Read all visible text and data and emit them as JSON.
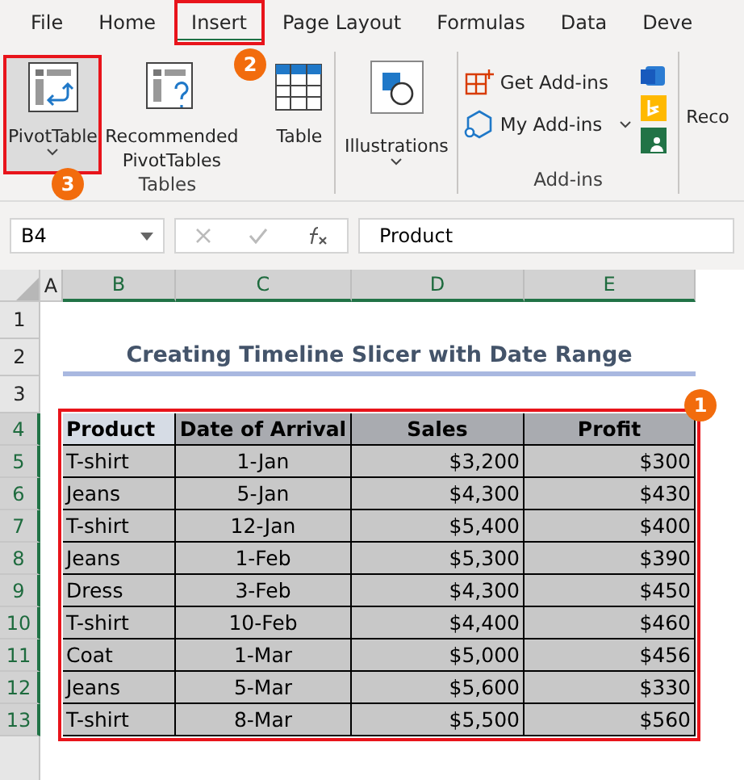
{
  "tabs": [
    {
      "label": "File",
      "selected": false
    },
    {
      "label": "Home",
      "selected": false
    },
    {
      "label": "Insert",
      "selected": true,
      "callout": "2"
    },
    {
      "label": "Page Layout",
      "selected": false
    },
    {
      "label": "Formulas",
      "selected": false
    },
    {
      "label": "Data",
      "selected": false
    },
    {
      "label": "Deve",
      "selected": false
    }
  ],
  "ribbon": {
    "groups": [
      {
        "label": "Tables",
        "buttons": [
          {
            "label": "PivotTable",
            "has_menu": true,
            "selected": true,
            "callout": "3"
          },
          {
            "label": "Recommended PivotTables",
            "has_menu": false,
            "selected": false
          },
          {
            "label": "Table",
            "has_menu": false,
            "selected": false
          }
        ]
      },
      {
        "buttons": [
          {
            "label": "Illustrations",
            "has_menu": true,
            "selected": false
          }
        ]
      },
      {
        "label": "Add-ins",
        "small_buttons": [
          {
            "label": "Get Add-ins",
            "has_menu": false
          },
          {
            "label": "My Add-ins",
            "has_menu": true
          }
        ]
      }
    ],
    "cut_off_label": "Reco"
  },
  "formula_bar": {
    "name_box": "B4",
    "formula": "Product"
  },
  "sheet": {
    "columns": [
      {
        "label": "A",
        "selected": false
      },
      {
        "label": "B",
        "selected": true
      },
      {
        "label": "C",
        "selected": true
      },
      {
        "label": "D",
        "selected": true
      },
      {
        "label": "E",
        "selected": true
      }
    ],
    "rows": [
      {
        "label": "1",
        "selected": false
      },
      {
        "label": "2",
        "selected": false
      },
      {
        "label": "3",
        "selected": false
      },
      {
        "label": "4",
        "selected": true
      },
      {
        "label": "5",
        "selected": true
      },
      {
        "label": "6",
        "selected": true
      },
      {
        "label": "7",
        "selected": true
      },
      {
        "label": "8",
        "selected": true
      },
      {
        "label": "9",
        "selected": true
      },
      {
        "label": "10",
        "selected": true
      },
      {
        "label": "11",
        "selected": true
      },
      {
        "label": "12",
        "selected": true
      },
      {
        "label": "13",
        "selected": true
      }
    ],
    "title": "Creating Timeline Slicer with Date Range",
    "table": {
      "callout": "1",
      "columns": [
        "Product",
        "Date of Arrival",
        "Sales",
        "Profit"
      ],
      "rows": [
        [
          "T-shirt",
          "1-Jan",
          "$3,200",
          "$300"
        ],
        [
          "Jeans",
          "5-Jan",
          "$4,300",
          "$430"
        ],
        [
          "T-shirt",
          "12-Jan",
          "$5,400",
          "$400"
        ],
        [
          "Jeans",
          "1-Feb",
          "$5,300",
          "$390"
        ],
        [
          "Dress",
          "3-Feb",
          "$4,300",
          "$450"
        ],
        [
          "T-shirt",
          "10-Feb",
          "$4,400",
          "$460"
        ],
        [
          "Coat",
          "1-Mar",
          "$5,000",
          "$456"
        ],
        [
          "Jeans",
          "5-Mar",
          "$5,600",
          "$330"
        ],
        [
          "T-shirt",
          "8-Mar",
          "$5,500",
          "$560"
        ]
      ]
    }
  }
}
